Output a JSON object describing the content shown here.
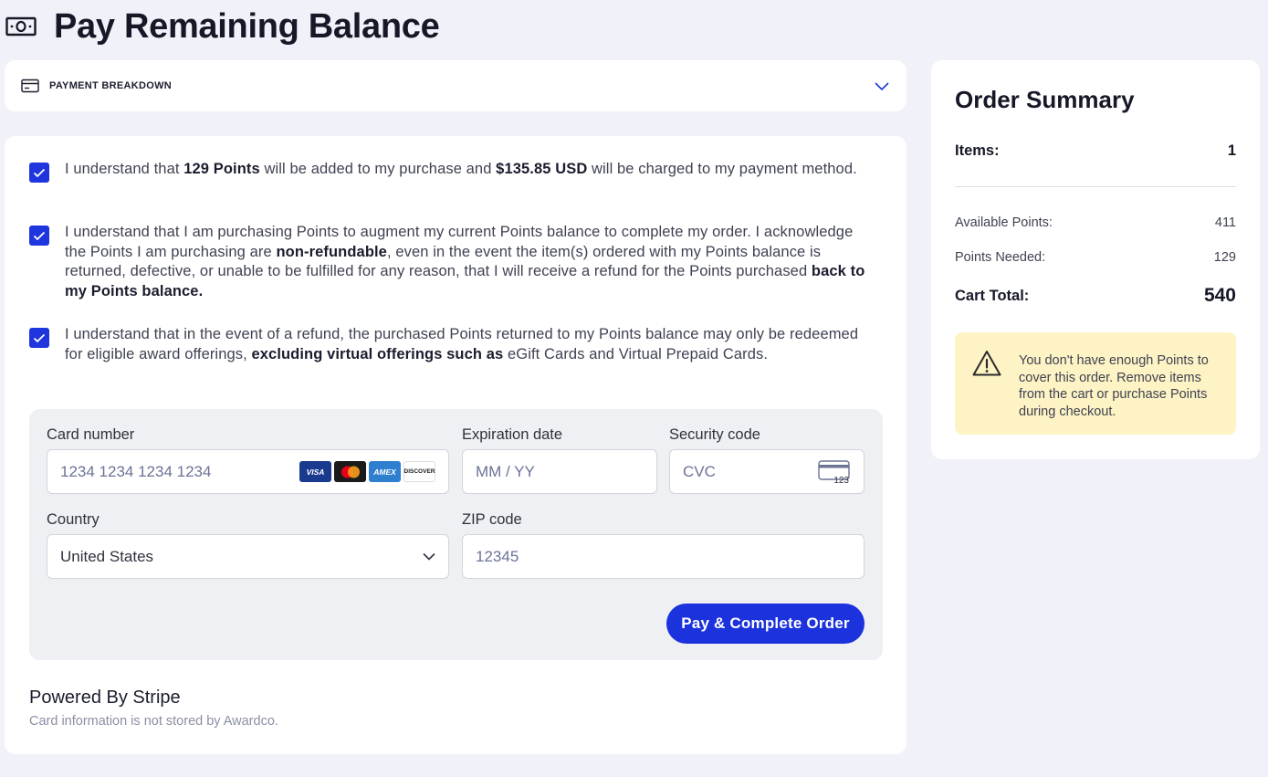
{
  "header": {
    "title": "Pay Remaining Balance",
    "icon": "money-icon"
  },
  "breakdown": {
    "label": "PAYMENT BREAKDOWN",
    "icon": "credit-card-icon",
    "toggle_icon": "chevron-down-icon"
  },
  "agreements": [
    {
      "checked": true,
      "parts": [
        {
          "t": "I understand that ",
          "b": false
        },
        {
          "t": "129 Points",
          "b": true
        },
        {
          "t": " will be added to my purchase and ",
          "b": false
        },
        {
          "t": "$135.85 USD",
          "b": true
        },
        {
          "t": " will be charged to my payment method.",
          "b": false
        }
      ]
    },
    {
      "checked": true,
      "parts": [
        {
          "t": "I understand that I am purchasing Points to augment my current Points balance to complete my order. I acknowledge the Points I am purchasing are ",
          "b": false
        },
        {
          "t": "non-refundable",
          "b": true
        },
        {
          "t": ", even in the event the item(s) ordered with my Points balance is returned, defective, or unable to be fulfilled for any reason, that I will receive a refund for the Points purchased ",
          "b": false
        },
        {
          "t": "back to my Points balance.",
          "b": true
        }
      ]
    },
    {
      "checked": true,
      "parts": [
        {
          "t": "I understand that in the event of a refund, the purchased Points returned to my Points balance may only be redeemed for eligible award offerings, ",
          "b": false
        },
        {
          "t": "excluding virtual offerings such as",
          "b": true
        },
        {
          "t": " eGift Cards and Virtual Prepaid Cards.",
          "b": false
        }
      ]
    }
  ],
  "payment_form": {
    "card_number": {
      "label": "Card number",
      "placeholder": "1234 1234 1234 1234"
    },
    "card_brands": [
      {
        "name": "VISA",
        "color": "#1a3a8f"
      },
      {
        "name": "",
        "color": "#1b1b1b"
      },
      {
        "name": "AMEX",
        "color": "#2f7fd0"
      },
      {
        "name": "DISCOVER",
        "color": "#ffffff"
      }
    ],
    "expiration": {
      "label": "Expiration date",
      "placeholder": "MM / YY"
    },
    "security": {
      "label": "Security code",
      "placeholder": "CVC",
      "icon_text": "123"
    },
    "country": {
      "label": "Country",
      "value": "United States"
    },
    "zip": {
      "label": "ZIP code",
      "placeholder": "12345"
    },
    "submit_label": "Pay & Complete Order"
  },
  "footer": {
    "powered_by": "Powered By Stripe",
    "note": "Card information is not stored by Awardco."
  },
  "summary": {
    "title": "Order Summary",
    "items_label": "Items:",
    "items_value": "1",
    "available_label": "Available Points:",
    "available_value": "411",
    "needed_label": "Points Needed:",
    "needed_value": "129",
    "total_label": "Cart Total:",
    "total_value": "540",
    "warning": "You don't have enough Points to cover this order. Remove items from the cart or purchase Points during checkout."
  },
  "colors": {
    "accent": "#1f35dd",
    "warning_bg": "#fdf3c4",
    "page_bg": "#f1f2f9"
  }
}
